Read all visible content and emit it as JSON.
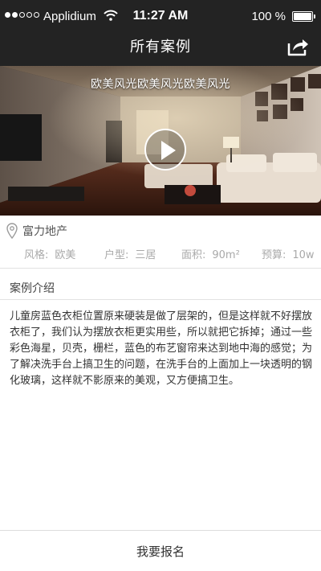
{
  "status_bar": {
    "carrier": "Applidium",
    "time": "11:27 AM",
    "battery": "100 %",
    "battery_level": 1.0
  },
  "nav": {
    "title": "所有案例",
    "share_icon": "share-icon"
  },
  "hero": {
    "caption": "欧美风光欧美风光欧美风光",
    "play_icon": "play-icon"
  },
  "case": {
    "location_icon": "location-pin-icon",
    "location": "富力地产",
    "specs": {
      "style_label": "风格:",
      "style_value": "欧美",
      "layout_label": "户型:",
      "layout_value": "三居",
      "area_label": "面积:",
      "area_value": "90m²",
      "budget_label": "预算:",
      "budget_value": "10w"
    }
  },
  "intro": {
    "title": "案例介绍",
    "body": "儿童房蓝色衣柜位置原来硬装是做了层架的，但是这样就不好摆放衣柜了，我们认为摆放衣柜更实用些，所以就把它拆掉；通过一些彩色海星，贝壳，栅栏，蓝色的布艺窗帘来达到地中海的感觉；为了解决洗手台上搞卫生的问题，在洗手台的上面加上一块透明的钢化玻璃，这样就不影原来的美观，又方便搞卫生。"
  },
  "footer": {
    "signup_label": "我要报名"
  },
  "colors": {
    "bar_background": "#232323",
    "spec_text": "#a9a9a9",
    "divider": "#e2e2e2"
  }
}
